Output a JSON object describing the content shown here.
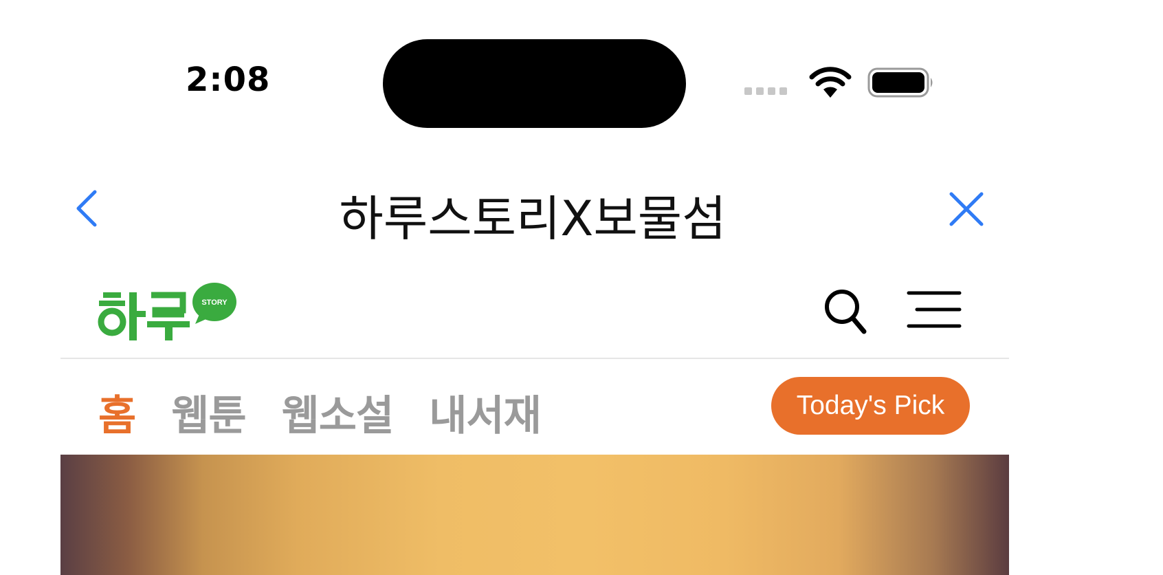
{
  "status_bar": {
    "time": "2:08"
  },
  "nav": {
    "title": "하루스토리X보물섬",
    "back_icon": "chevron-left-icon",
    "close_icon": "close-icon",
    "accent": "#2f7bf5"
  },
  "header": {
    "logo_alt": "하루 STORY",
    "search_icon": "search-icon",
    "menu_icon": "hamburger-menu-icon"
  },
  "tabs": [
    {
      "label": "홈",
      "active": true
    },
    {
      "label": "웹툰",
      "active": false
    },
    {
      "label": "웹소설",
      "active": false
    },
    {
      "label": "내서재",
      "active": false
    }
  ],
  "today_pick": {
    "label": "Today's Pick",
    "color": "#e8702b"
  },
  "colors": {
    "brand_green": "#3aab3f",
    "active_tab": "#e8702b",
    "inactive_tab": "#9a9a9a"
  }
}
